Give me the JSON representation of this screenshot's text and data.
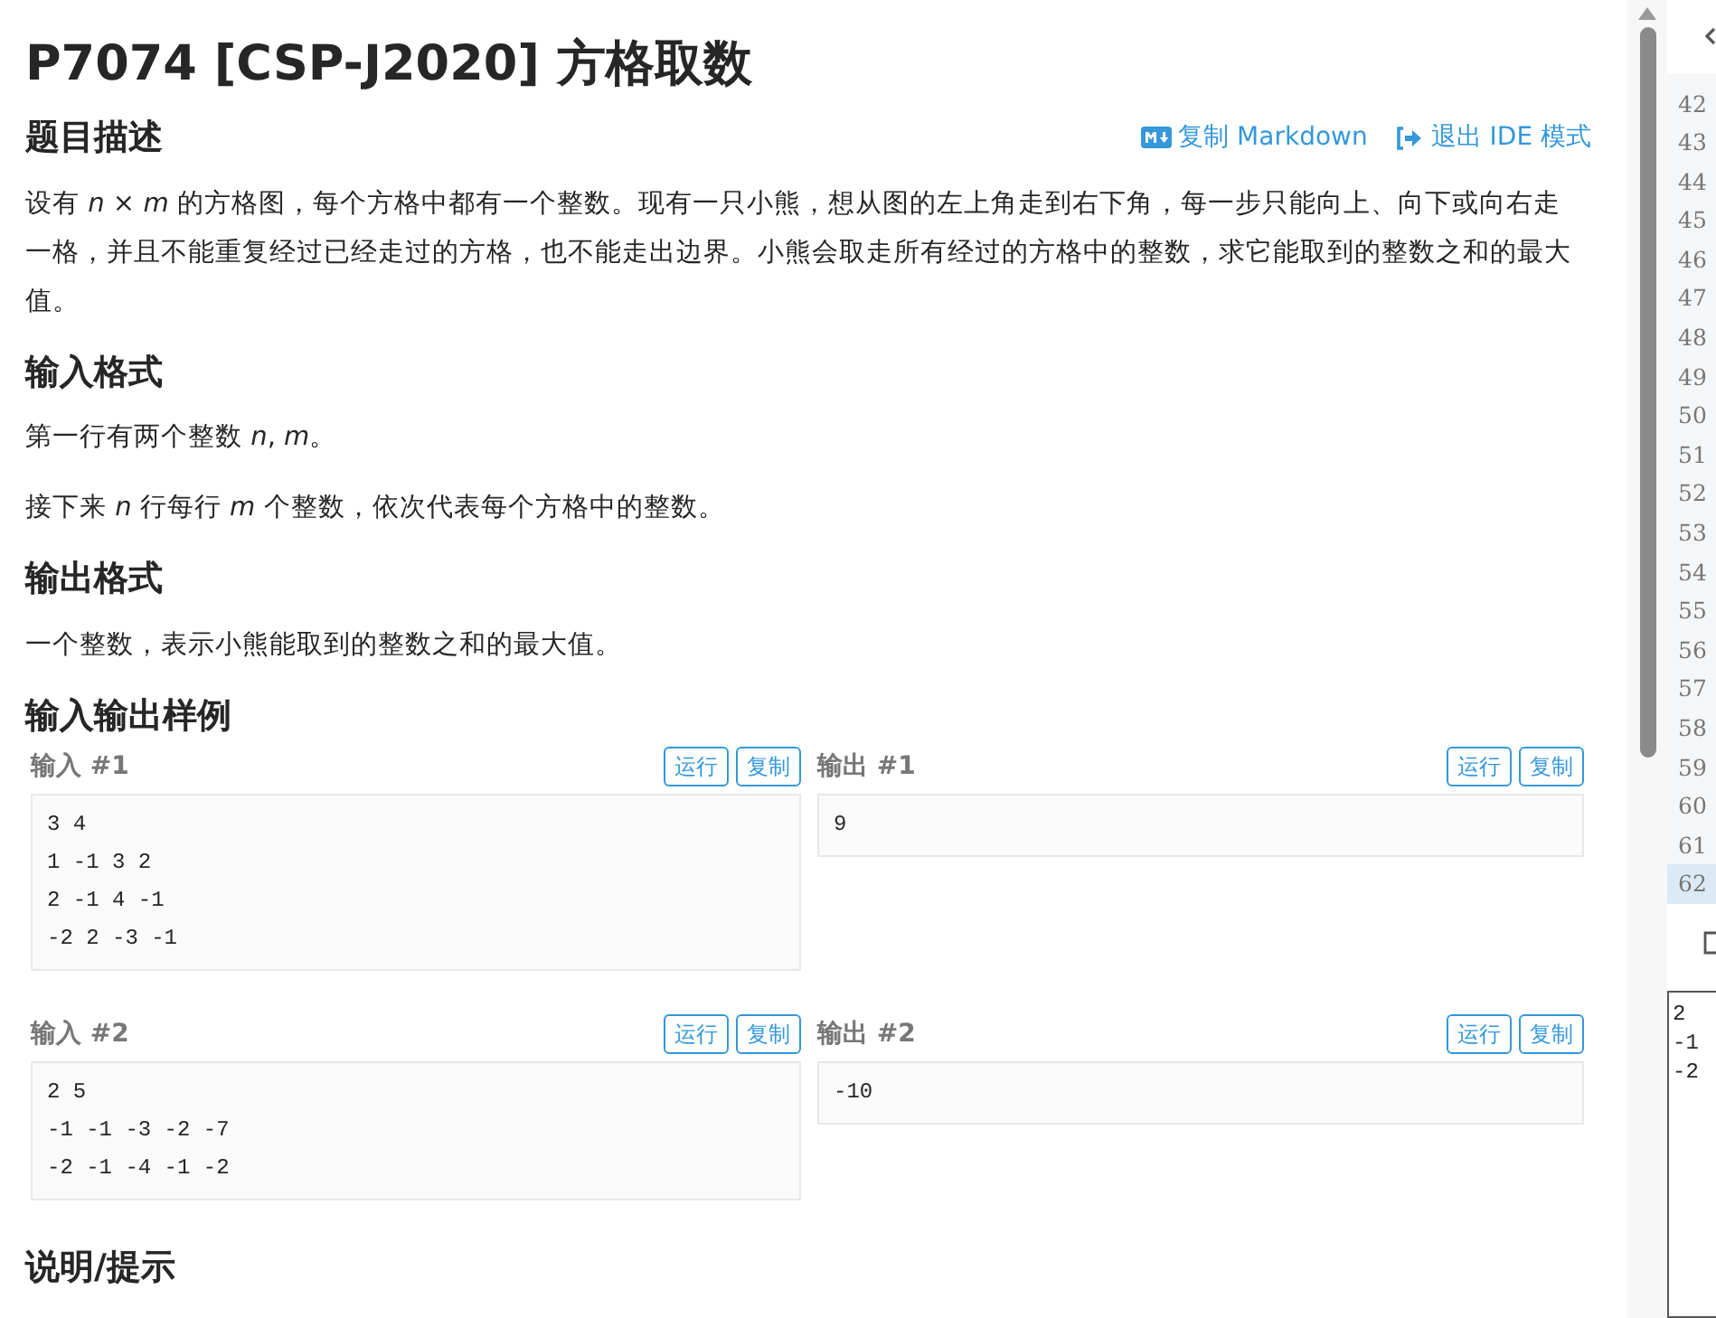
{
  "title": "P7074 [CSP-J2020] 方格取数",
  "actions": [
    {
      "kind": "markdown",
      "label": "复制 Markdown"
    },
    {
      "kind": "exit",
      "label": "退出 IDE 模式"
    }
  ],
  "sections": [
    {
      "heading": "题目描述",
      "paragraphs": [
        "设有 *n* × *m* 的方格图，每个方格中都有一个整数。现有一只小熊，想从图的左上角走到右下角，每一步只能向上、向下或向右走一格，并且不能重复经过已经走过的方格，也不能走出边界。小熊会取走所有经过的方格中的整数，求它能取到的整数之和的最大值。"
      ]
    },
    {
      "heading": "输入格式",
      "paragraphs": [
        "第一行有两个整数 *n*, *m*。",
        "接下来 *n* 行每行 *m* 个整数，依次代表每个方格中的整数。"
      ]
    },
    {
      "heading": "输出格式",
      "paragraphs": [
        "一个整数，表示小熊能取到的整数之和的最大值。"
      ]
    }
  ],
  "samples_heading": "输入输出样例",
  "samples": [
    {
      "input_label": "输入 #1",
      "output_label": "输出 #1",
      "input_run": "运行",
      "input_copy": "复制",
      "output_run": "运行",
      "output_copy": "复制",
      "input": [
        "3 4",
        "1 -1 3 2",
        "2 -1 4 -1",
        "-2 2 -3 -1"
      ],
      "output": [
        "9"
      ]
    },
    {
      "input_label": "输入 #2",
      "output_label": "输出 #2",
      "input_run": "运行",
      "input_copy": "复制",
      "output_run": "运行",
      "output_copy": "复制",
      "input": [
        "2 5",
        "-1 -1 -3 -2 -7",
        "-2 -1 -4 -1 -2"
      ],
      "output": [
        "-10"
      ]
    }
  ],
  "hint_heading": "说明/提示",
  "editor": {
    "line_numbers": [
      {
        "label": "42",
        "selected": false
      },
      {
        "label": "43",
        "selected": false
      },
      {
        "label": "44",
        "selected": false
      },
      {
        "label": "45",
        "selected": false
      },
      {
        "label": "46",
        "selected": false
      },
      {
        "label": "47",
        "selected": false
      },
      {
        "label": "48",
        "selected": false
      },
      {
        "label": "49",
        "selected": false
      },
      {
        "label": "50",
        "selected": false
      },
      {
        "label": "51",
        "selected": false
      },
      {
        "label": "52",
        "selected": false
      },
      {
        "label": "53",
        "selected": false
      },
      {
        "label": "54",
        "selected": false
      },
      {
        "label": "55",
        "selected": false
      },
      {
        "label": "56",
        "selected": false
      },
      {
        "label": "57",
        "selected": false
      },
      {
        "label": "58",
        "selected": false
      },
      {
        "label": "59",
        "selected": false
      },
      {
        "label": "60",
        "selected": false
      },
      {
        "label": "61",
        "selected": false
      },
      {
        "label": "62",
        "selected": true
      }
    ],
    "input_lines": [
      "2",
      "-1",
      "-2"
    ]
  }
}
